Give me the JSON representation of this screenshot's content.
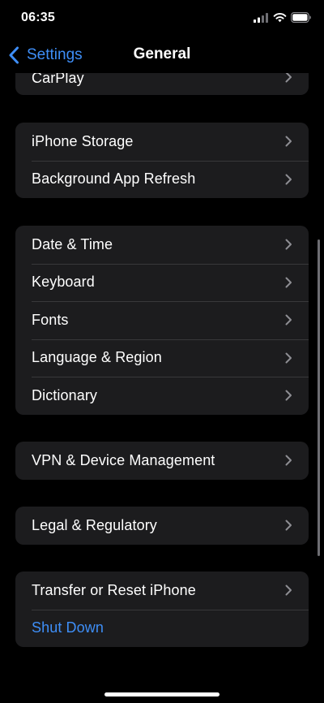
{
  "status_bar": {
    "time": "06:35",
    "icons": [
      "signal-icon",
      "wifi-icon",
      "battery-icon"
    ]
  },
  "nav": {
    "back_label": "Settings",
    "title": "General",
    "back_icon": "chevron-left-icon"
  },
  "colors": {
    "background": "#000000",
    "cell": "#1c1c1e",
    "separator": "#38383a",
    "accent": "#3e8ef7",
    "chevron": "#8e8e93"
  },
  "groups": {
    "g0": {
      "items": [
        {
          "label": "CarPlay"
        }
      ]
    },
    "g1": {
      "items": [
        {
          "label": "iPhone Storage"
        },
        {
          "label": "Background App Refresh"
        }
      ]
    },
    "g2": {
      "items": [
        {
          "label": "Date & Time"
        },
        {
          "label": "Keyboard"
        },
        {
          "label": "Fonts"
        },
        {
          "label": "Language & Region"
        },
        {
          "label": "Dictionary"
        }
      ]
    },
    "g3": {
      "items": [
        {
          "label": "VPN & Device Management"
        }
      ]
    },
    "g4": {
      "items": [
        {
          "label": "Legal & Regulatory"
        }
      ]
    },
    "g5": {
      "items": [
        {
          "label": "Transfer or Reset iPhone"
        },
        {
          "label": "Shut Down"
        }
      ]
    }
  }
}
